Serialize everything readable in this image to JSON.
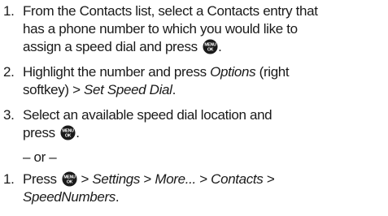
{
  "steps": [
    {
      "number": "1.",
      "lines": [
        "From the Contacts list, select a Contacts entry that",
        "has a phone number to which you would like to",
        "assign a speed dial and press"
      ],
      "tail": "."
    },
    {
      "number": "2.",
      "line1_pre": "Highlight the number and press ",
      "line1_em": "Options",
      "line1_post": " (right",
      "line2_pre": "softkey) ",
      "line2_gt": ">",
      "line2_em": " Set Speed Dial",
      "line2_post": "."
    },
    {
      "number": "3.",
      "line1": "Select an available speed dial location and",
      "line2_pre": "press",
      "line2_post": "."
    }
  ],
  "or_separator": "– or –",
  "alt_step": {
    "number": "1.",
    "pre": "Press",
    "gt1": " > ",
    "item1": "Settings",
    "gt2": " > ",
    "item2": "More...",
    "gt3": " > ",
    "item3": "Contacts",
    "gt4": " >",
    "item4": "SpeedNumbers",
    "tail": "."
  },
  "menu_key": {
    "top_text": "MENU",
    "bottom_text": "OK",
    "color": "#1a1a1a"
  }
}
